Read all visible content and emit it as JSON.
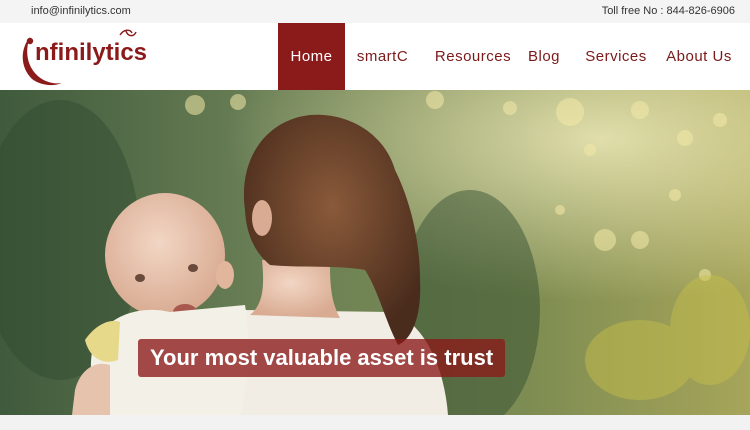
{
  "topbar": {
    "email": "info@infinilytics.com",
    "phone": "Toll free No : 844-826-6906"
  },
  "brand": {
    "logo_text": "infinilytics",
    "logo_color": "#8b1a1a"
  },
  "nav": {
    "items": [
      {
        "label": "Home",
        "active": true
      },
      {
        "label": "smartC",
        "active": false
      },
      {
        "label": "Resources",
        "active": false
      },
      {
        "label": "Blog",
        "active": false
      },
      {
        "label": "Services",
        "active": false
      },
      {
        "label": "About Us",
        "active": false
      }
    ]
  },
  "hero": {
    "tagline": "Your most valuable asset is trust"
  },
  "colors": {
    "accent": "#8b1a1a",
    "topbar_bg": "#f4f4f4"
  }
}
